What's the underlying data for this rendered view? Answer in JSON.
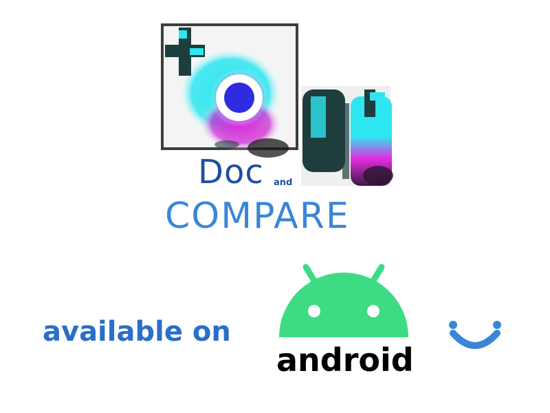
{
  "brand": {
    "doc_text": "Doc",
    "and_text": "and",
    "compare_text": "COMPARE",
    "logo_icon": "camera-collage-icon"
  },
  "availability": {
    "label": "available on",
    "platform_name": "android",
    "platform_icon": "android-robot-icon",
    "smile_icon": "smile-icon"
  },
  "colors": {
    "doc_blue": "#1d4fa3",
    "compare_blue": "#3a86d6",
    "available_blue": "#2a6fc9",
    "android_green": "#3ddc84",
    "cyan": "#2ee6f0",
    "magenta": "#e32be0",
    "dark_teal": "#1e3d3d"
  }
}
